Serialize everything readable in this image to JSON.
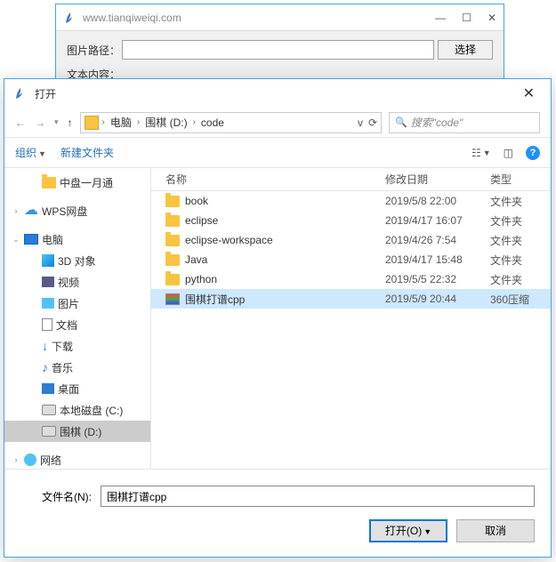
{
  "parent": {
    "title": "www.tianqiweiqi.com",
    "labels": {
      "path": "图片路径：",
      "content": "文本内容："
    },
    "select_btn": "选择"
  },
  "dialog": {
    "title": "打开",
    "breadcrumb": [
      "电脑",
      "围棋 (D:)",
      "code"
    ],
    "search_placeholder": "搜索\"code\"",
    "toolbar": {
      "organize": "组织",
      "new_folder": "新建文件夹"
    },
    "columns": {
      "name": "名称",
      "date": "修改日期",
      "type": "类型"
    },
    "files": [
      {
        "name": "book",
        "date": "2019/5/8 22:00",
        "type": "文件夹",
        "icon": "folder",
        "selected": false
      },
      {
        "name": "eclipse",
        "date": "2019/4/17 16:07",
        "type": "文件夹",
        "icon": "folder",
        "selected": false
      },
      {
        "name": "eclipse-workspace",
        "date": "2019/4/26 7:54",
        "type": "文件夹",
        "icon": "folder",
        "selected": false
      },
      {
        "name": "Java",
        "date": "2019/4/17 15:48",
        "type": "文件夹",
        "icon": "folder",
        "selected": false
      },
      {
        "name": "python",
        "date": "2019/5/5 22:32",
        "type": "文件夹",
        "icon": "folder",
        "selected": false
      },
      {
        "name": "围棋打谱cpp",
        "date": "2019/5/9 20:44",
        "type": "360压缩",
        "icon": "zip",
        "selected": true
      }
    ],
    "tree": [
      {
        "label": "中盘一月通",
        "icon": "folder",
        "indent": 1,
        "twisty": ""
      },
      {
        "label": "WPS网盘",
        "icon": "wps",
        "indent": 0,
        "twisty": ">"
      },
      {
        "label": "电脑",
        "icon": "pc",
        "indent": 0,
        "twisty": "v"
      },
      {
        "label": "3D 对象",
        "icon": "obj3d",
        "indent": 1,
        "twisty": ""
      },
      {
        "label": "视频",
        "icon": "video",
        "indent": 1,
        "twisty": ""
      },
      {
        "label": "图片",
        "icon": "pic",
        "indent": 1,
        "twisty": ""
      },
      {
        "label": "文档",
        "icon": "doc",
        "indent": 1,
        "twisty": ""
      },
      {
        "label": "下载",
        "icon": "down",
        "indent": 1,
        "twisty": ""
      },
      {
        "label": "音乐",
        "icon": "music",
        "indent": 1,
        "twisty": ""
      },
      {
        "label": "桌面",
        "icon": "desk",
        "indent": 1,
        "twisty": ""
      },
      {
        "label": "本地磁盘 (C:)",
        "icon": "drive",
        "indent": 1,
        "twisty": ""
      },
      {
        "label": "围棋 (D:)",
        "icon": "drive",
        "indent": 1,
        "twisty": "",
        "selected": true
      },
      {
        "label": "网络",
        "icon": "net",
        "indent": 0,
        "twisty": ">"
      }
    ],
    "filename_label": "文件名(N):",
    "filename_value": "围棋打谱cpp",
    "open_btn": "打开(O)",
    "cancel_btn": "取消"
  }
}
